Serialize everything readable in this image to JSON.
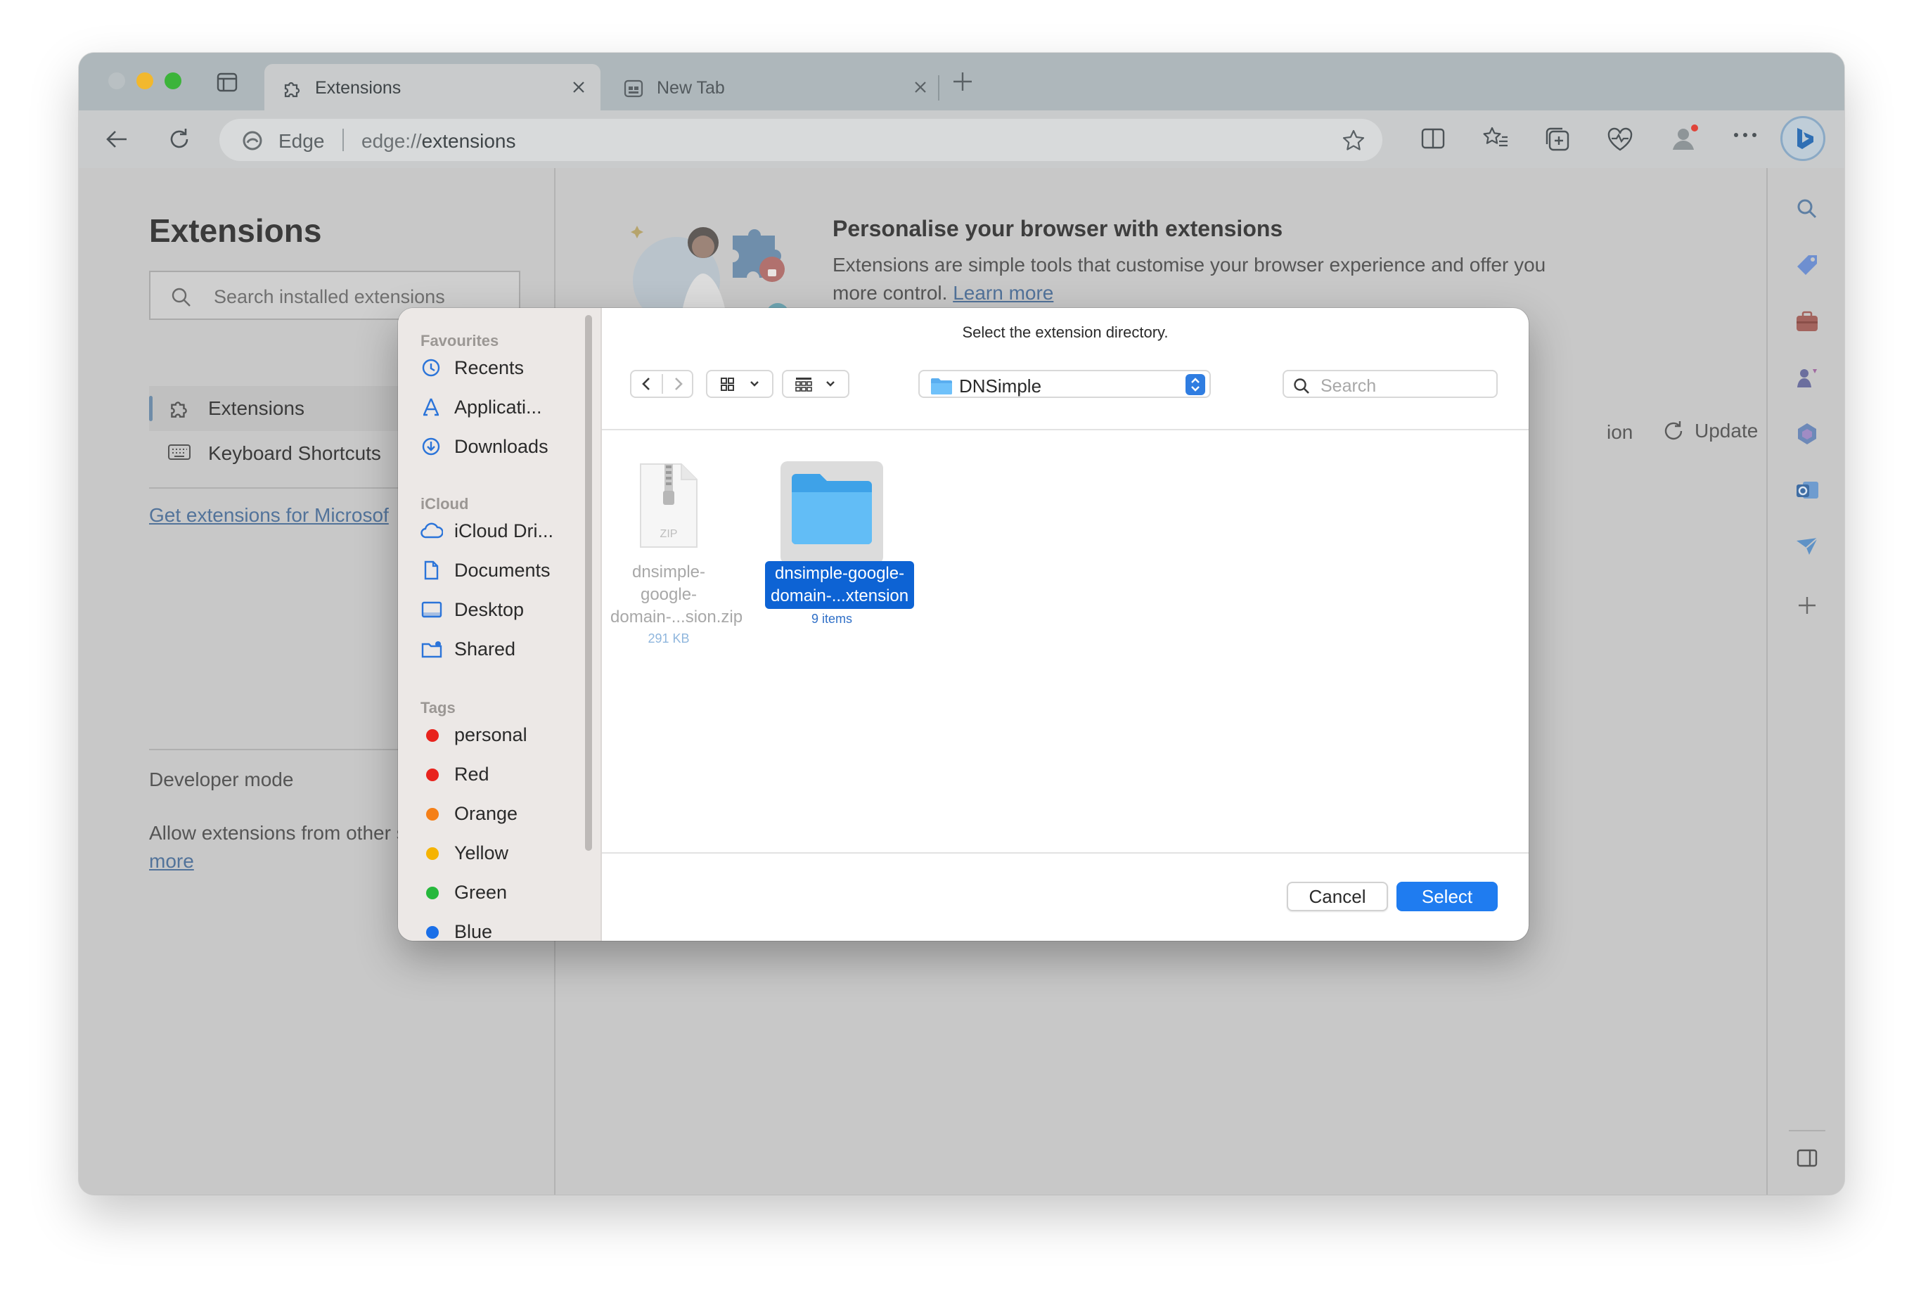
{
  "browser": {
    "tabs": [
      {
        "title": "Extensions",
        "icon": "puzzle-icon",
        "active": true
      },
      {
        "title": "New Tab",
        "icon": "newtab-icon",
        "active": false
      }
    ],
    "address": {
      "site_label": "Edge",
      "url_prefix": "edge://",
      "url_path": "extensions"
    }
  },
  "extensions_page": {
    "title": "Extensions",
    "search_placeholder": "Search installed extensions",
    "nav": [
      {
        "label": "Extensions",
        "icon": "puzzle-icon",
        "active": true
      },
      {
        "label": "Keyboard Shortcuts",
        "icon": "keyboard-icon",
        "active": false
      }
    ],
    "get_extensions_link": "Get extensions for Microsof",
    "developer_mode": "Developer mode",
    "allow_text": "Allow extensions from other stores.",
    "allow_link": "Learn more",
    "banner_title": "Personalise your browser with extensions",
    "banner_desc": "Extensions are simple tools that customise your browser experience and offer you more control.",
    "banner_link": "Learn more",
    "hidden_button_fragment": "ion",
    "update_label": "Update"
  },
  "dialog": {
    "title": "Select the extension directory.",
    "location": "DNSimple",
    "search_placeholder": "Search",
    "sidebar": {
      "favourites_header": "Favourites",
      "favourites": [
        {
          "label": "Recents",
          "icon": "clock-icon"
        },
        {
          "label": "Applicati...",
          "icon": "applications-icon"
        },
        {
          "label": "Downloads",
          "icon": "download-icon"
        }
      ],
      "icloud_header": "iCloud",
      "icloud": [
        {
          "label": "iCloud Dri...",
          "icon": "cloud-icon"
        },
        {
          "label": "Documents",
          "icon": "document-icon"
        },
        {
          "label": "Desktop",
          "icon": "desktop-icon"
        },
        {
          "label": "Shared",
          "icon": "shared-folder-icon"
        }
      ],
      "tags_header": "Tags",
      "tags": [
        {
          "label": "personal",
          "color": "#e8231d"
        },
        {
          "label": "Red",
          "color": "#e8231d"
        },
        {
          "label": "Orange",
          "color": "#f57f17"
        },
        {
          "label": "Yellow",
          "color": "#f5b300"
        },
        {
          "label": "Green",
          "color": "#26b83c"
        },
        {
          "label": "Blue",
          "color": "#1a6fe8"
        }
      ]
    },
    "files": [
      {
        "name_line1": "dnsimple-google-",
        "name_line2": "domain-...sion.zip",
        "meta": "291 KB",
        "icon": "zip-file-icon",
        "selected": false
      },
      {
        "name_line1": "dnsimple-google-",
        "name_line2": "domain-...xtension",
        "meta": "9 items",
        "icon": "folder-icon",
        "selected": true
      }
    ],
    "cancel_label": "Cancel",
    "select_label": "Select",
    "zip_badge": "ZIP"
  }
}
